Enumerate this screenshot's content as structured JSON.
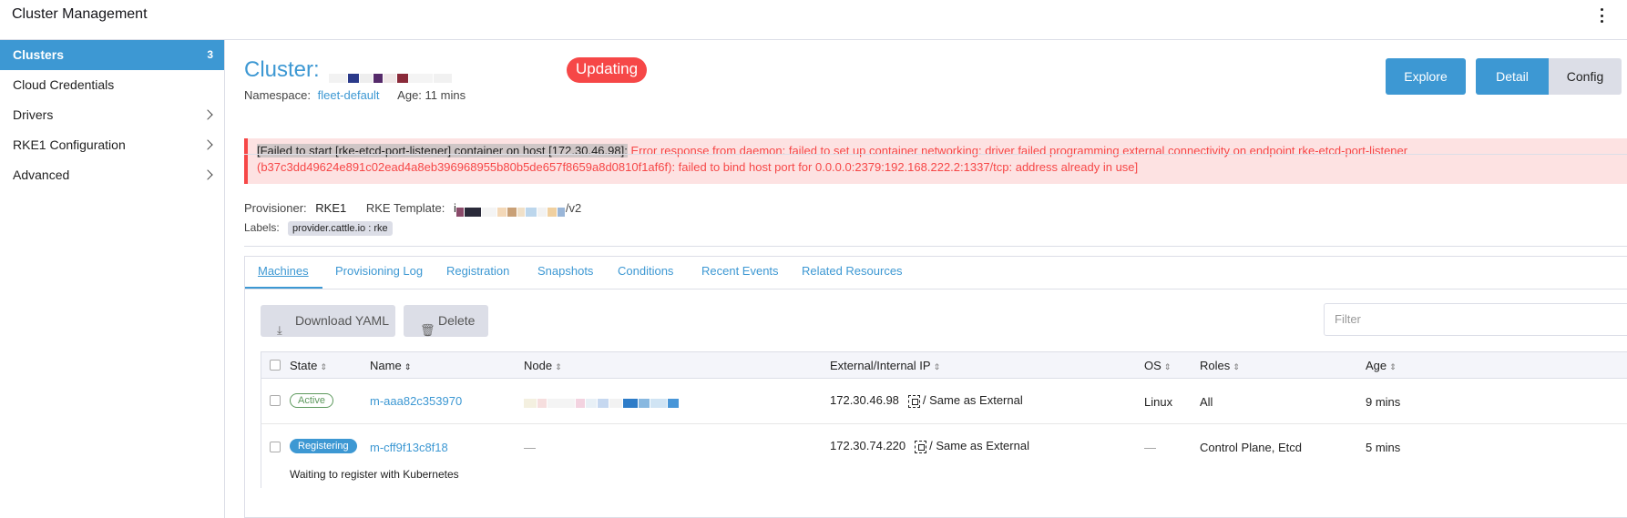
{
  "app": {
    "title": "Cluster Management"
  },
  "sidebar": {
    "items": [
      {
        "label": "Clusters",
        "count": "3"
      },
      {
        "label": "Cloud Credentials"
      },
      {
        "label": "Drivers"
      },
      {
        "label": "RKE1 Configuration"
      },
      {
        "label": "Advanced"
      }
    ]
  },
  "header": {
    "title_prefix": "Cluster:",
    "status": "Updating",
    "namespace_label": "Namespace:",
    "namespace_value": "fleet-default",
    "age": "Age: 11 mins",
    "buttons": {
      "explore": "Explore",
      "detail": "Detail",
      "config": "Config"
    }
  },
  "error": {
    "highlight": "[Failed to start [rke-etcd-port-listener] container on host [172.30.46.98]:",
    "message": " Error response from daemon: failed to set up container networking: driver failed programming external connectivity on endpoint rke-etcd-port-listener (b37c3dd49624e891c02ead4a8eb396968955b80b5de657f8659a8d0810f1af6f): failed to bind host port for 0.0.0.0:2379:192.168.222.2:1337/tcp: address already in use]"
  },
  "details": {
    "provisioner_label": "Provisioner:",
    "provisioner_value": "RKE1",
    "template_label": "RKE Template:",
    "template_prefix": "i",
    "template_suffix": "/v2",
    "labels_label": "Labels:",
    "label_tag": "provider.cattle.io : rke"
  },
  "tabs": [
    "Machines",
    "Provisioning Log",
    "Registration",
    "Snapshots",
    "Conditions",
    "Recent Events",
    "Related Resources"
  ],
  "toolbar": {
    "download_label": "Download YAML",
    "delete_label": "Delete",
    "filter_placeholder": "Filter"
  },
  "table": {
    "headers": [
      "State",
      "Name",
      "Node",
      "External/Internal IP",
      "OS",
      "Roles",
      "Age"
    ],
    "rows": [
      {
        "state": "Active",
        "name": "m-aaa82c353970",
        "ip": "172.30.46.98",
        "ip_internal": "/ Same as External",
        "os": "Linux",
        "roles": "All",
        "age": "9 mins"
      },
      {
        "state": "Registering",
        "name": "m-cff9f13c8f18",
        "node": "—",
        "ip": "172.30.74.220",
        "ip_internal": "/ Same as External",
        "os": "—",
        "roles": "Control Plane, Etcd",
        "age": "5 mins",
        "sub_message": "Waiting to register with Kubernetes"
      }
    ]
  },
  "colors": {
    "accent": "#3d98d3",
    "error": "#f64747",
    "active_state": "#5d995d"
  }
}
